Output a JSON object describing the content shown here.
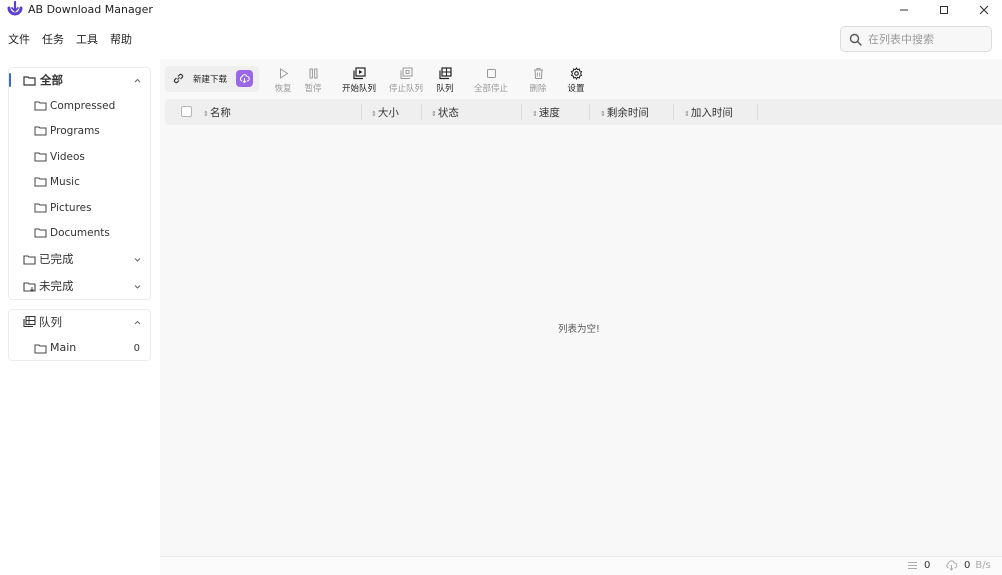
{
  "window": {
    "title": "AB Download Manager",
    "accent": "#3a6ad8",
    "brand": "#9b66e8"
  },
  "menu": [
    "文件",
    "任务",
    "工具",
    "帮助"
  ],
  "search": {
    "placeholder": "在列表中搜索",
    "value": ""
  },
  "sidebar": {
    "all_label": "全部",
    "categories": [
      {
        "label": "Compressed",
        "icon": "folder-icon"
      },
      {
        "label": "Programs",
        "icon": "folder-icon"
      },
      {
        "label": "Videos",
        "icon": "folder-icon"
      },
      {
        "label": "Music",
        "icon": "folder-icon"
      },
      {
        "label": "Pictures",
        "icon": "folder-icon"
      },
      {
        "label": "Documents",
        "icon": "folder-icon"
      }
    ],
    "finished_label": "已完成",
    "unfinished_label": "未完成",
    "queues_label": "队列",
    "queues": [
      {
        "label": "Main",
        "count": "0"
      }
    ]
  },
  "toolbar": {
    "new_download": "新建下载",
    "resume": "恢复",
    "pause": "暂停",
    "start_queue": "开始队列",
    "stop_queue": "停止队列",
    "queue": "队列",
    "stop_all": "全部停止",
    "delete": "删除",
    "settings": "设置"
  },
  "table": {
    "columns": [
      "名称",
      "大小",
      "状态",
      "速度",
      "剩余时间",
      "加入时间"
    ],
    "empty_message": "列表为空!"
  },
  "status": {
    "active_count": "0",
    "speed": "0",
    "speed_unit": "B/s"
  }
}
